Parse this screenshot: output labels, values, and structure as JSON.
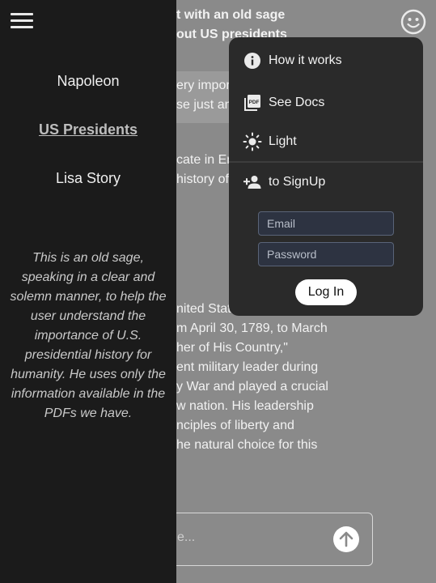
{
  "chat": {
    "title_lines": [
      "t with an old sage",
      "out US presidents"
    ],
    "user_lines": [
      "ery import",
      "se just an"
    ],
    "reply_lines": [
      "cate in En",
      "history of"
    ],
    "answer_lines": [
      "nited Stat",
      "m April 30, 1789, to March",
      "her of His Country,\"",
      "ent military leader during",
      "y War and played a crucial",
      "w nation. His leadership",
      "nciples of liberty and",
      "he natural choice for this"
    ],
    "input_placeholder": "e..."
  },
  "sidebar": {
    "items": [
      {
        "label": "Napoleon"
      },
      {
        "label": "US Presidents"
      },
      {
        "label": "Lisa Story"
      }
    ],
    "description": "This is an old sage, speaking in a clear and solemn manner, to help the user understand the importance of U.S. presidential history for humanity. He uses only the information available in the PDFs we have."
  },
  "menu": {
    "how_it_works": "How it works",
    "see_docs": "See Docs",
    "theme": "Light",
    "signup": "to SignUp",
    "email_placeholder": "Email",
    "password_placeholder": "Password",
    "login_label": "Log In"
  },
  "icons": {
    "menu": "hamburger-icon",
    "profile": "smiley-icon",
    "info": "info-icon",
    "pdf": "pdf-icon",
    "theme": "sun-icon",
    "signup": "person-add-icon",
    "send": "arrow-up-icon"
  },
  "colors": {
    "sidebar_bg": "#1b1b1b",
    "menu_bg": "#2a2a2a",
    "page_bg": "#8a8a8a"
  }
}
